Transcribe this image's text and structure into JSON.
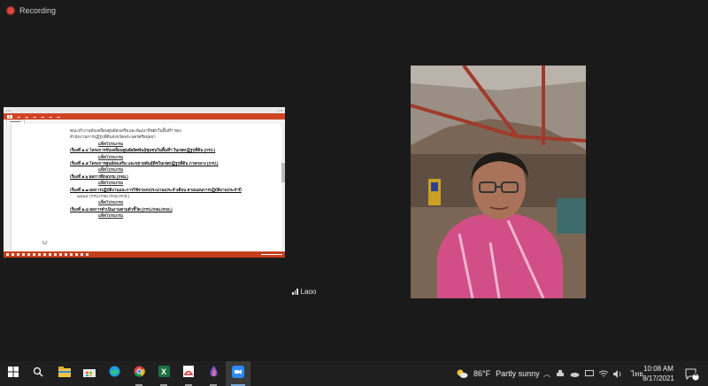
{
  "meeting": {
    "recording_label": "Recording",
    "participant_name": "Laoo"
  },
  "shared_document": {
    "lines": [
      {
        "text": "คณะทำงานขับเคลื่อนศูนย์ส่งเสริมและพัฒนาพืชผักในพื้นที่ฯ ของ",
        "style": "plain"
      },
      {
        "text": "สำนักงานการปฏิรูปที่ดินจังหวัดพระนครศรีอยุธยา",
        "style": "plain"
      },
      {
        "text": "แพ็ทโปรแกรม",
        "style": "sig"
      },
      {
        "text": "เรื่องที่ ๑.๔  โครงการขับเคลื่อนศูนย์ผลิตพันธุ์ชุมชนในพื้นที่ฯ ในเขตปฏิรูปที่ดิน (กรป.)",
        "style": "item"
      },
      {
        "text": "แพ็ทโปรแกรม",
        "style": "sig"
      },
      {
        "text": "เรื่องที่ ๑.๕  โครงการศูนย์ส่งเสริม และขยายพันธุ์พืชในเขตปฏิรูปที่ดิน ภาคกลาง (กรป.)",
        "style": "item"
      },
      {
        "text": "แพ็ทโปรแกรม",
        "style": "sig"
      },
      {
        "text": "เรื่องที่ ๑.๖  ผลการฝึกอบรม (กจม.)",
        "style": "item"
      },
      {
        "text": "แพ็ทโปรแกรม",
        "style": "sig"
      },
      {
        "text": "เรื่องที่ ๑.๗  ผลการปฏิบัติงานและการใช้จ่ายงบประมาณประจำเดือน ตามแผนการปฏิบัติงานประจำปี",
        "style": "item"
      },
      {
        "text": "๒๕๖๔ (กรป./กจม./กกอ./กกจ.)",
        "style": "indent"
      },
      {
        "text": "แพ็ทโปรแกรม",
        "style": "sig"
      },
      {
        "text": "เรื่องที่ ๑.๘  ผลการดำเนินงานตามตัวชี้วัด (กรป./กจม./กกอ.)",
        "style": "item"
      },
      {
        "text": "แพ็ทโปรแกรม",
        "style": "sig"
      }
    ]
  },
  "taskbar": {
    "apps": [
      {
        "name": "windows-start-icon",
        "state": ""
      },
      {
        "name": "search-icon",
        "state": ""
      },
      {
        "name": "file-explorer-icon",
        "state": ""
      },
      {
        "name": "store-icon",
        "state": ""
      },
      {
        "name": "edge-icon",
        "state": ""
      },
      {
        "name": "chrome-icon",
        "state": "running"
      },
      {
        "name": "excel-icon",
        "state": "running"
      },
      {
        "name": "pdf-reader-icon",
        "state": "running"
      },
      {
        "name": "onedrive-drop-icon",
        "state": "running"
      },
      {
        "name": "zoom-icon",
        "state": "active"
      }
    ],
    "weather": {
      "temp": "86°F",
      "condition": "Partly sunny"
    },
    "language": "ไทย",
    "time": "10:08 AM",
    "date": "8/17/2021",
    "notification_count": "4"
  }
}
